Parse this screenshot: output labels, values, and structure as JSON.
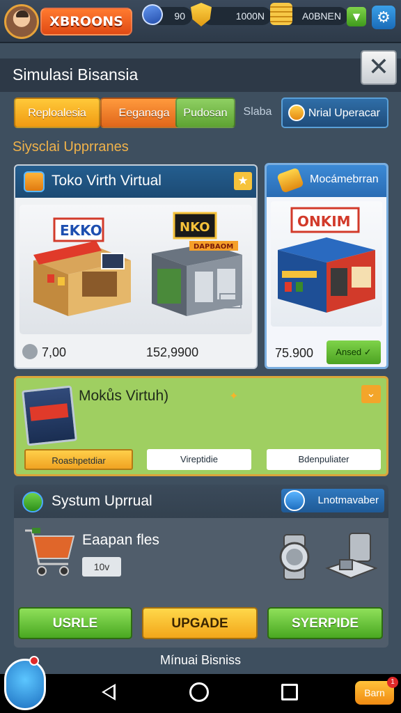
{
  "header": {
    "brand": "XBROONS",
    "resources": [
      {
        "icon": "gem-icon",
        "value": "90"
      },
      {
        "icon": "shield-icon",
        "value": "1000N"
      },
      {
        "icon": "coins-icon",
        "value": "A0BNEN"
      }
    ]
  },
  "window": {
    "title": "Simulasi Bisansia",
    "close_label": "✕"
  },
  "tabs": [
    {
      "label": "Reploalesia"
    },
    {
      "label": "Eeganaga"
    },
    {
      "label": "Pudosan"
    },
    {
      "label": "Slaba"
    },
    {
      "label": "Nrial Uperacar"
    }
  ],
  "section_label": "Siysclai Upprranes",
  "shop_main": {
    "title": "Toko Virth Virtual",
    "sign_a": "EKKO",
    "sign_b": "NKO",
    "sign_b_sub": "DAPBAOM",
    "price_a": "7,00",
    "price_b": "152,9900"
  },
  "shop_side": {
    "title": "Mocámebrran",
    "sign": "ONKIM",
    "price": "75.900",
    "buy_label": "Ansed"
  },
  "promo": {
    "title": "Mokůs Virtuh)",
    "buttons": [
      "Roashpetdiar",
      "Vireptidie",
      "Bdenpuliater"
    ]
  },
  "system": {
    "title": "Systum Uprrual",
    "tab_label": "Lnotmavaber",
    "item": "Eaapan fles",
    "count": "10v",
    "buttons": [
      "USRLE",
      "UPGADE",
      "SYERPIDE"
    ]
  },
  "footer": {
    "label": "Mínuai Bisniss",
    "fab_right": "Barn",
    "fab_right_badge": "1"
  },
  "colors": {
    "background": "#3e4f5f",
    "accent_orange": "#f09a12",
    "accent_green": "#49a821",
    "panel_blue": "#1c4a73",
    "promo_green": "#9fcf61"
  }
}
